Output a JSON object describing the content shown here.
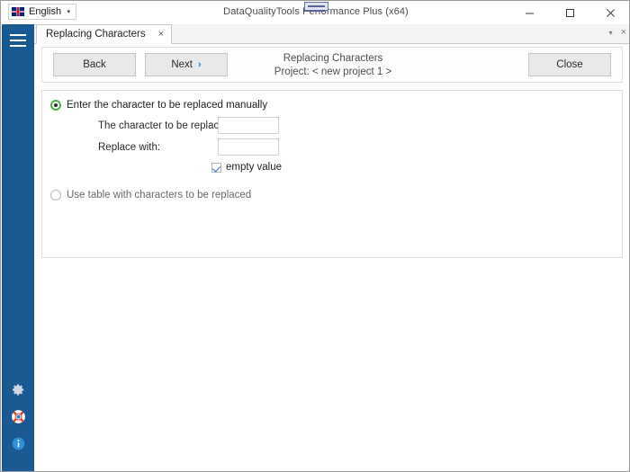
{
  "window": {
    "title": "DataQualityTools Performance Plus (x64)",
    "minimize_label": "minimize-icon",
    "maximize_label": "maximize-icon",
    "close_label": "close-icon"
  },
  "language_selector": {
    "value": "English",
    "flag": "united-kingdom-flag",
    "caret": "▾"
  },
  "sidebar": {
    "menu_icon": "hamburger-menu-icon",
    "bottom_items": [
      {
        "icon": "gear-icon",
        "name": "settings"
      },
      {
        "icon": "lifebuoy-icon",
        "name": "support"
      },
      {
        "icon": "info-icon",
        "name": "about"
      }
    ]
  },
  "tabstrip": {
    "tabs": [
      {
        "label": "Replacing Characters",
        "close": "×",
        "active": true
      }
    ],
    "overflow_caret": "▾",
    "close_all": "×"
  },
  "toolbar": {
    "back_label": "Back",
    "next_label": "Next",
    "next_chevron": "›",
    "close_label": "Close",
    "header_title": "Replacing Characters",
    "header_project": "Project: < new project 1 >"
  },
  "panel": {
    "option_manual": {
      "label": "Enter the character to be replaced manually",
      "selected": true
    },
    "fields": [
      {
        "label": "The character to be replaced:",
        "value": "",
        "placeholder": ""
      },
      {
        "label": "Replace with:",
        "value": "",
        "placeholder": ""
      }
    ],
    "empty_value_checkbox": {
      "label": "empty value",
      "checked": true
    },
    "option_table": {
      "label": "Use table with characters to be replaced",
      "selected": false
    }
  },
  "colors": {
    "brand_blue": "#1b5993",
    "accent_blue": "#1b7fd4",
    "radio_green": "#4eae4e",
    "check_blue": "#2b6cb8"
  }
}
